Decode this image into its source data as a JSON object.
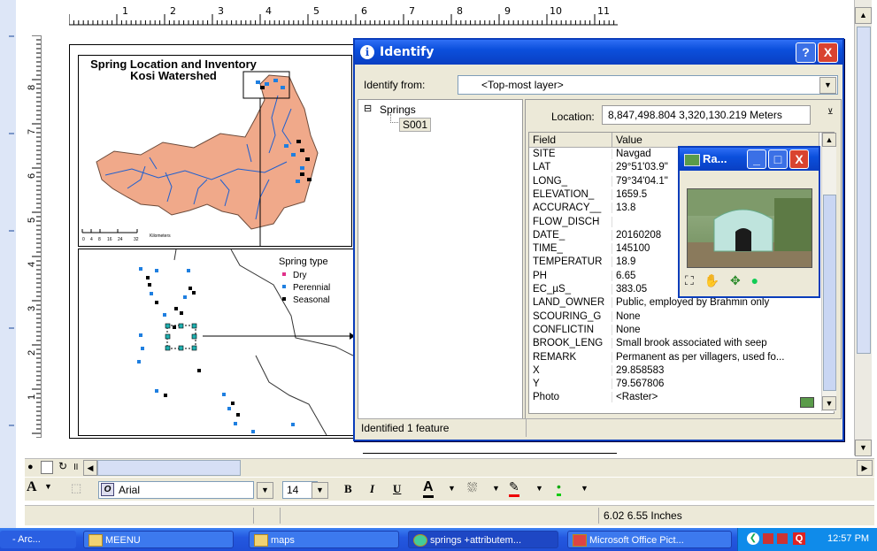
{
  "top_ruler": {
    "numbers": [
      "1",
      "2",
      "3",
      "4",
      "5",
      "6",
      "7",
      "8",
      "9",
      "10",
      "11"
    ]
  },
  "left_ruler": {
    "numbers": [
      "8",
      "7",
      "6",
      "5",
      "4",
      "3",
      "2",
      "1"
    ]
  },
  "map_top": {
    "title_line1": "Spring Location and Inventory",
    "title_line2": "Kosi Watershed",
    "scale_text": "Kilometers",
    "scale_ticks": [
      "0",
      "4",
      "8",
      "16",
      "24",
      "32"
    ]
  },
  "map_bottom": {
    "legend_title": "Spring type",
    "legend_items": [
      {
        "label": "Dry",
        "color": "#e0308a"
      },
      {
        "label": "Perennial",
        "color": "#1f7fe0"
      },
      {
        "label": "Seasonal",
        "color": "#000000"
      }
    ]
  },
  "identify": {
    "title": "Identify",
    "help_btn": "?",
    "close_btn": "X",
    "from_label": "Identify from:",
    "from_value": "<Top-most layer>",
    "tree": {
      "expander": "⊟",
      "layer": "Springs",
      "feature": "S001"
    },
    "location_label": "Location:",
    "location_value": "8,847,498.804  3,320,130.219 Meters",
    "col_field": "Field",
    "col_value": "Value",
    "rows": [
      {
        "f": "SITE",
        "v": "Navgad"
      },
      {
        "f": "LAT",
        "v": "29°51'03.9\""
      },
      {
        "f": "LONG_",
        "v": "79°34'04.1\""
      },
      {
        "f": "ELEVATION_",
        "v": "1659.5"
      },
      {
        "f": "ACCURACY__",
        "v": "13.8"
      },
      {
        "f": "FLOW_DISCH",
        "v": ""
      },
      {
        "f": "DATE_",
        "v": "20160208"
      },
      {
        "f": "TIME_",
        "v": "145100"
      },
      {
        "f": "TEMPERATUR",
        "v": "18.9"
      },
      {
        "f": "PH",
        "v": "6.65"
      },
      {
        "f": "EC_µS_",
        "v": "383.05"
      },
      {
        "f": "LAND_OWNER",
        "v": "Public, employed by Brahmin only"
      },
      {
        "f": "SCOURING_G",
        "v": "None"
      },
      {
        "f": "CONFLICTIN",
        "v": "None"
      },
      {
        "f": "BROOK_LENG",
        "v": "Small brook associated with seep"
      },
      {
        "f": "REMARK",
        "v": "Permanent as per villagers, used fo..."
      },
      {
        "f": "X",
        "v": "29.858583"
      },
      {
        "f": "Y",
        "v": "79.567806"
      },
      {
        "f": "Photo",
        "v": "<Raster>"
      }
    ],
    "status": "Identified 1 feature"
  },
  "raster_window": {
    "title": "Ra..."
  },
  "toolbar": {
    "font_name": "Arial",
    "font_size": "14",
    "bold": "B",
    "italic": "I",
    "underline": "U",
    "text_a": "A"
  },
  "statusline": {
    "page_coords": "6.02  6.55 Inches"
  },
  "taskbar": {
    "items": [
      {
        "label": "- Arc..."
      },
      {
        "label": "MEENU"
      },
      {
        "label": "maps"
      },
      {
        "label": "springs +attributem..."
      },
      {
        "label": "Microsoft Office Pict..."
      }
    ],
    "clock": "12:57 PM"
  },
  "colors": {
    "title_bar": "#0b4fdc",
    "watershed": "#f0a98a",
    "river": "#1d5fd0",
    "taskbar": "#2458e0"
  }
}
